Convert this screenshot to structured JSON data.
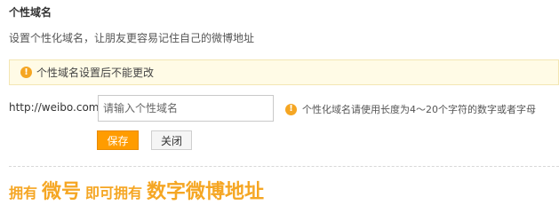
{
  "header": {
    "title": "个性域名",
    "subtitle": "设置个性化域名，让朋友更容易记住自己的微博地址"
  },
  "notice": {
    "icon": "warning-icon",
    "text": "个性域名设置后不能更改"
  },
  "form": {
    "url_prefix": "http://weibo.com/",
    "input_placeholder": "请输入个性域名",
    "input_value": "",
    "hint_icon": "warning-icon",
    "hint": "个性化域名请使用长度为4～20个字符的数字或者字母",
    "save_label": "保存",
    "close_label": "关闭"
  },
  "promo": {
    "part1": "拥有",
    "part2": "微号",
    "part3": "即可拥有",
    "part4": "数字微博地址"
  },
  "colors": {
    "accent": "#f5a623",
    "save_button": "#ff9c00",
    "notice_background": "#fffbe6"
  }
}
